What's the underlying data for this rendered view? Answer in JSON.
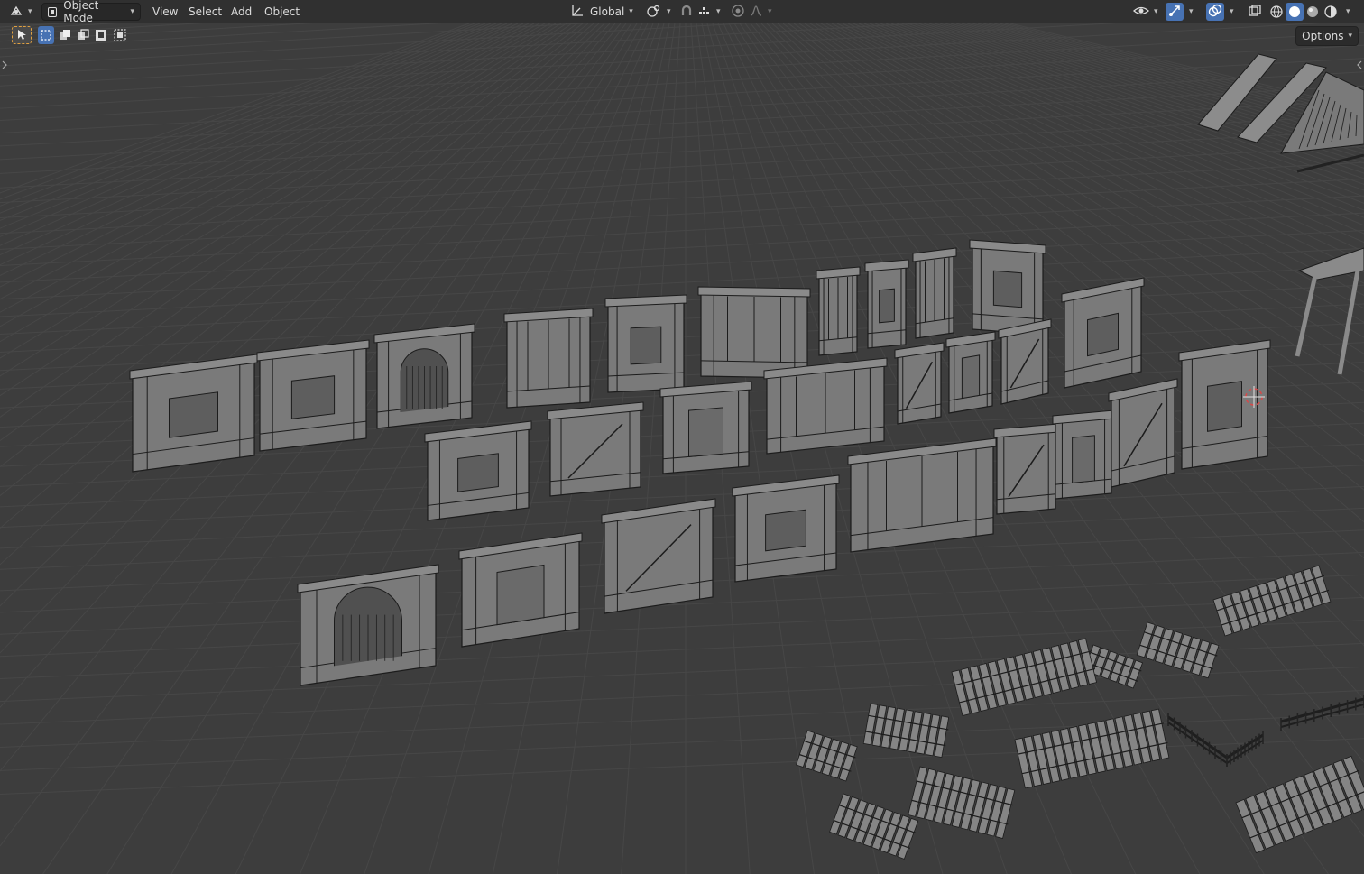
{
  "header": {
    "editor_type_icon": "viewport-editor-icon",
    "mode": {
      "icon": "object-mode-icon",
      "label": "Object Mode"
    },
    "menus": [
      "View",
      "Select",
      "Add",
      "Object"
    ],
    "transform_orientation": {
      "icon": "orientation-icon",
      "label": "Global"
    },
    "pivot_icon": "pivot-point-icon",
    "snap_icons": [
      "snap-magnet-icon",
      "snap-increment-icon"
    ],
    "proportional_icons": [
      "proportional-edit-icon",
      "falloff-curve-icon"
    ],
    "right_icons": [
      "visibility-eye-icon",
      "gizmo-icon",
      "overlay-icon",
      "xray-icon"
    ],
    "shading_modes": [
      "wireframe-shading-icon",
      "solid-shading-icon",
      "material-preview-icon",
      "rendered-shading-icon"
    ],
    "active_shading": "solid-shading-icon"
  },
  "toolbar": {
    "select_tool_icon": "select-box-tool-icon",
    "select_modes": [
      "select-new-icon",
      "select-extend-icon",
      "select-subtract-icon",
      "select-invert-icon",
      "select-intersect-icon"
    ],
    "options_label": "Options"
  },
  "colors": {
    "viewport_bg": "#3d3d3d",
    "grid_line": "#474747",
    "grid_axis_line": "#4d4d4d",
    "header_bg": "#303030",
    "mesh_fill": "#7a7a7a",
    "mesh_edge": "#1c1c1c",
    "accent": "#4772b3",
    "cursor_red": "#d24b4b"
  }
}
